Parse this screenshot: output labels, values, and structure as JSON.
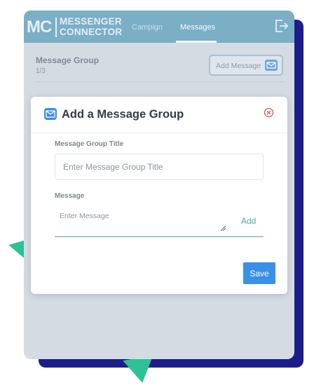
{
  "app": {
    "logo_mark": "MC",
    "logo_line1": "MESSENGER",
    "logo_line2": "CONNECTOR"
  },
  "nav": {
    "tabs": [
      {
        "label": "Campign",
        "active": false
      },
      {
        "label": "Messages",
        "active": true
      }
    ],
    "exit_icon": "logout-icon"
  },
  "page": {
    "group_title": "Message Group",
    "group_count": "1/3",
    "add_message_label": "Add Message",
    "add_message_icon": "envelope-icon"
  },
  "modal": {
    "title": "Add a Message Group",
    "header_icon": "envelope-icon",
    "close_icon": "close-circle-icon",
    "title_field": {
      "label": "Message Group Title",
      "placeholder": "Enter Message Group Title",
      "value": ""
    },
    "message_field": {
      "label": "Message",
      "placeholder": "Enter Message",
      "value": ""
    },
    "add_label": "Add",
    "save_label": "Save"
  },
  "colors": {
    "topbar": "#7aafc6",
    "accent_blue": "#3a90e4",
    "accent_teal": "#4ea79d",
    "decor_navy": "#1c1c8a",
    "decor_green": "#2cc293",
    "close_red": "#e05555"
  }
}
